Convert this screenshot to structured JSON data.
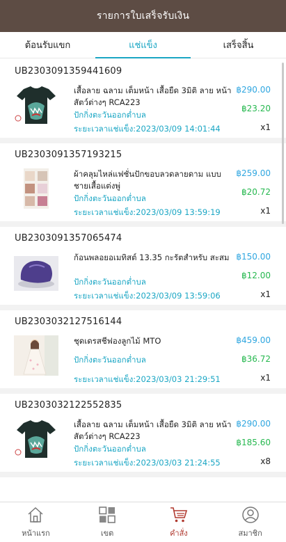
{
  "header": {
    "title": "รายการใบเสร็จรับเงิน"
  },
  "tabs": [
    {
      "label": "ต้อนรับแขก"
    },
    {
      "label": "แช่แข็ง"
    },
    {
      "label": "เสร็จสิ้น"
    }
  ],
  "orders": [
    {
      "id": "UB2303091359441609",
      "name": "เสื้อลาย ฉลาม เต็มหน้า เสื้อยืด 3มิติ ลาย หน้าสัตว์ต่างๆ RCA223",
      "shipping": "ปักกิ่งตะวันออกต่ำบล",
      "freeze_time": "ระยะเวลาแช่แข็ง:2023/03/09 14:01:44",
      "price": "฿290.00",
      "commission": "฿23.20",
      "qty": "x1"
    },
    {
      "id": "UB2303091357193215",
      "name": "ผ้าคลุมไหล่แฟชั่นปักขอบลวดลายดาม แบบ ชายเสื้อแต่งพู่",
      "shipping": "ปักกิ่งตะวันออกต่ำบล",
      "freeze_time": "ระยะเวลาแช่แข็ง:2023/03/09 13:59:19",
      "price": "฿259.00",
      "commission": "฿20.72",
      "qty": "x1"
    },
    {
      "id": "UB2303091357065474",
      "name": "ก้อนพลอยอเมทิสต์ 13.35 กะรัตสำหรับ สะสม",
      "shipping": "ปักกิ่งตะวันออกต่ำบล",
      "freeze_time": "ระยะเวลาแช่แข็ง:2023/03/09 13:59:06",
      "price": "฿150.00",
      "commission": "฿12.00",
      "qty": "x1"
    },
    {
      "id": "UB2303032127516144",
      "name": "ชุดเดรสชีฟองลูกไม้ MTO",
      "shipping": "ปักกิ่งตะวันออกต่ำบล",
      "freeze_time": "ระยะเวลาแช่แข็ง:2023/03/03 21:29:51",
      "price": "฿459.00",
      "commission": "฿36.72",
      "qty": "x1"
    },
    {
      "id": "UB2303032122552835",
      "name": "เสื้อลาย ฉลาม เต็มหน้า เสื้อยืด 3มิติ ลาย หน้าสัตว์ต่างๆ RCA223",
      "shipping": "ปักกิ่งตะวันออกต่ำบล",
      "freeze_time": "ระยะเวลาแช่แข็ง:2023/03/03 21:24:55",
      "price": "฿290.00",
      "commission": "฿185.60",
      "qty": "x8"
    }
  ],
  "nav": [
    {
      "label": "หน้าแรก",
      "icon": "home-icon"
    },
    {
      "label": "เขต",
      "icon": "grid-icon"
    },
    {
      "label": "คำสั่ง",
      "icon": "cart-icon"
    },
    {
      "label": "สมาชิก",
      "icon": "user-icon"
    }
  ],
  "colors": {
    "header_bg": "#5d4c44",
    "accent": "#1aa6c4",
    "price": "#2fa6e0",
    "commission": "#26b84f",
    "nav_active": "#b0392f"
  }
}
